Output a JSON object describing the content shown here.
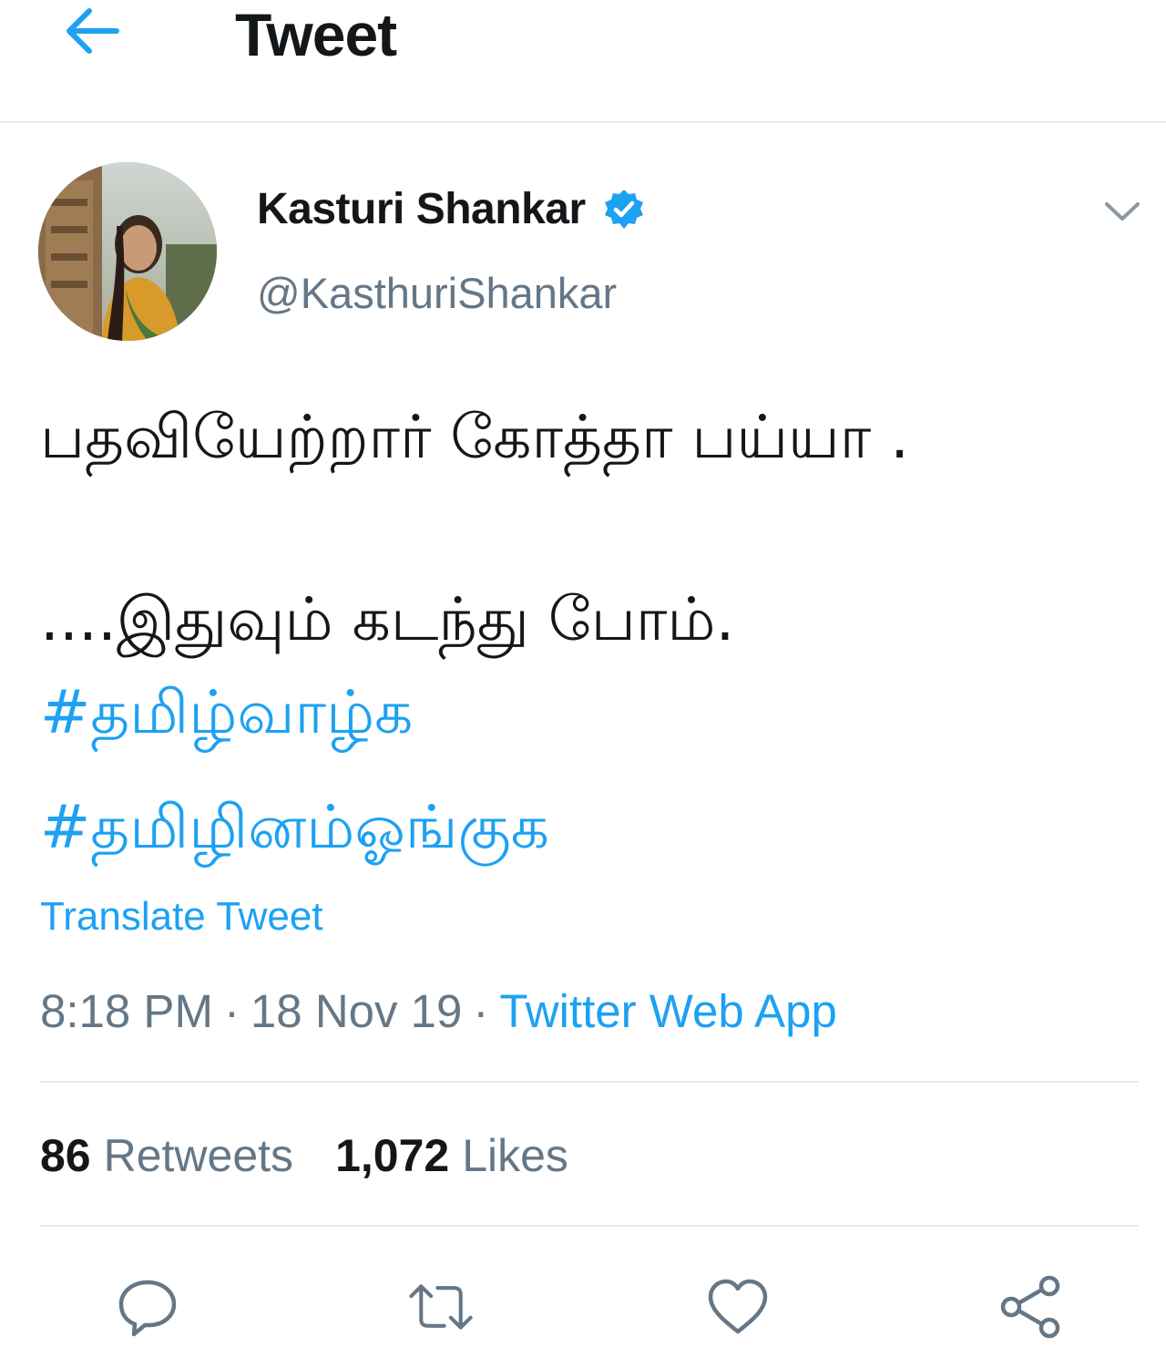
{
  "header": {
    "title": "Tweet",
    "back_icon": "arrow-left-icon"
  },
  "author": {
    "name": "Kasturi Shankar",
    "handle": "@KasthuriShankar",
    "verified_icon": "verified-badge-icon"
  },
  "tweet": {
    "line1": "பதவியேற்றார் கோத்தா பய்யா .",
    "line2": "....இதுவும் கடந்து போம்.",
    "hashtags": [
      "#தமிழ்வாழ்க",
      "#தமிழினம்ஓங்குக"
    ]
  },
  "translate_label": "Translate Tweet",
  "meta": {
    "time": "8:18 PM",
    "separator": "·",
    "date": "18 Nov 19",
    "source": "Twitter Web App"
  },
  "stats": {
    "retweets_count": "86",
    "retweets_label": "Retweets",
    "likes_count": "1,072",
    "likes_label": "Likes"
  },
  "actions": [
    "reply-icon",
    "retweet-icon",
    "like-icon",
    "share-icon"
  ],
  "colors": {
    "accent": "#1da1f2",
    "text": "#14171a",
    "secondary": "#657786",
    "divider": "#e6ecf0"
  }
}
